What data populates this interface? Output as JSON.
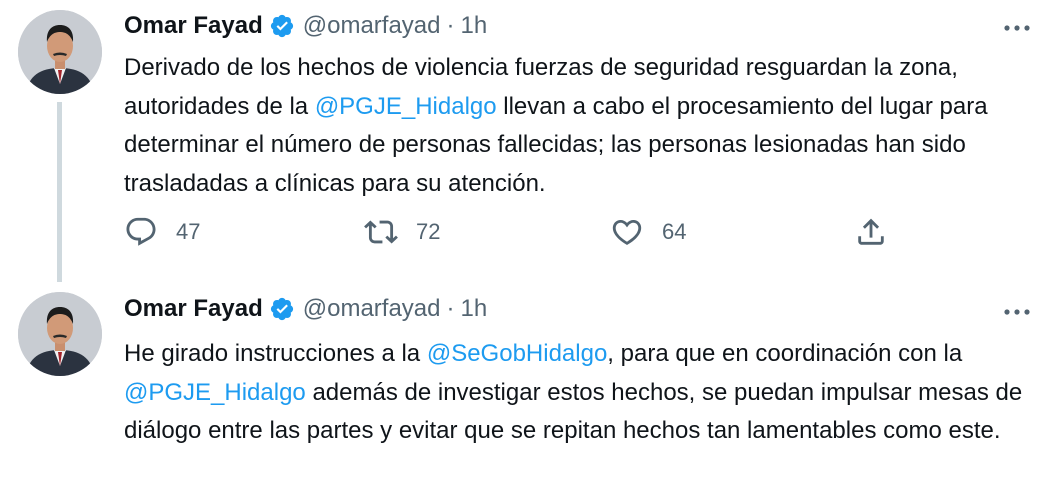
{
  "tweets": [
    {
      "name": "Omar Fayad",
      "handle": "@omarfayad",
      "separator": "·",
      "time": "1h",
      "text_parts": [
        "Derivado de los hechos de violencia fuerzas de seguridad resguardan la zona, autoridades de la ",
        "@PGJE_Hidalgo",
        " llevan a cabo el procesamiento del lugar para determinar el número de personas fallecidas; las personas lesionadas han sido trasladadas a clínicas para su atención."
      ],
      "replies": "47",
      "retweets": "72",
      "likes": "64"
    },
    {
      "name": "Omar Fayad",
      "handle": "@omarfayad",
      "separator": "·",
      "time": "1h",
      "text_parts": [
        "He girado instrucciones a la ",
        "@SeGobHidalgo",
        ", para que en coordinación con la ",
        "@PGJE_Hidalgo",
        " además de investigar estos hechos, se puedan impulsar mesas de diálogo entre las partes y evitar que se repitan hechos tan lamentables como este."
      ]
    }
  ],
  "colors": {
    "accent": "#1d9bf0",
    "text": "#0f1419",
    "muted": "#536471",
    "thread_line": "#cfd9de"
  },
  "icons": [
    "verified-badge-icon",
    "more-options-icon",
    "reply-icon",
    "retweet-icon",
    "like-icon",
    "share-icon"
  ]
}
